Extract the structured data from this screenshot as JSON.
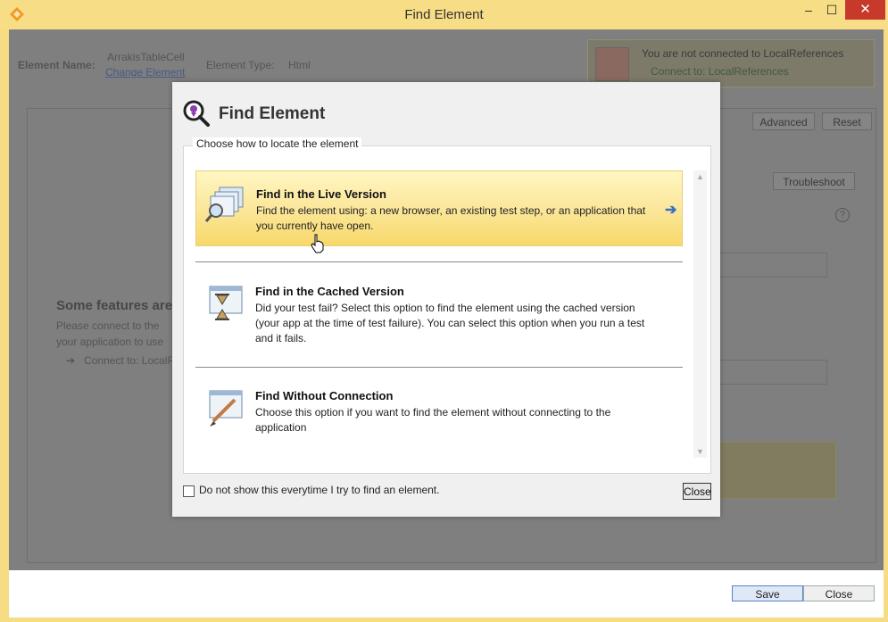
{
  "window": {
    "title": "Find Element",
    "min_label": "–",
    "max_label": "☐",
    "close_label": "✕"
  },
  "background": {
    "element_name_label": "Element Name:",
    "element_name_value": "ArrakisTableCell",
    "change_element_link": "Change Element",
    "element_type_label": "Element Type:",
    "element_type_value": "Html",
    "connection_status_prefix": "You are not connected to ",
    "connection_status_target": "LocalReferences",
    "connect_link": "Connect to: LocalReferences",
    "advanced_button": "Advanced",
    "reset_button": "Reset",
    "troubleshoot_button": "Troubleshoot",
    "features_heading": "Some features are",
    "features_text_1": "Please connect to the",
    "features_text_2": "your application to use",
    "features_connect_link": "Connect to: LocalR",
    "help_icon": "?"
  },
  "dialog": {
    "title": "Find Element",
    "group_label": "Choose how to locate the element",
    "options": [
      {
        "title": "Find in the Live Version",
        "description": "Find the element using: a new browser, an existing test step, or an application that you currently have open.",
        "icon": "browser-windows-magnifier-icon"
      },
      {
        "title": "Find in the Cached Version",
        "description": "Did your test fail? Select this option to find the element using the cached version (your app at the time of test failure). You can select this option when you run a test and it fails.",
        "icon": "hourglass-window-icon"
      },
      {
        "title": "Find Without Connection",
        "description": "Choose this option if you want to find the element without connecting to the application",
        "icon": "window-pen-icon"
      }
    ],
    "arrow_label": "➔",
    "checkbox_label": "Do not show this everytime I try to find an element.",
    "close_button": "Close"
  },
  "footer": {
    "save_button": "Save",
    "close_button": "Close"
  },
  "colors": {
    "frame": "#f6dc82",
    "highlight": "#fbe697",
    "close_red": "#c7392b",
    "arrow_blue": "#3b6fbf"
  }
}
